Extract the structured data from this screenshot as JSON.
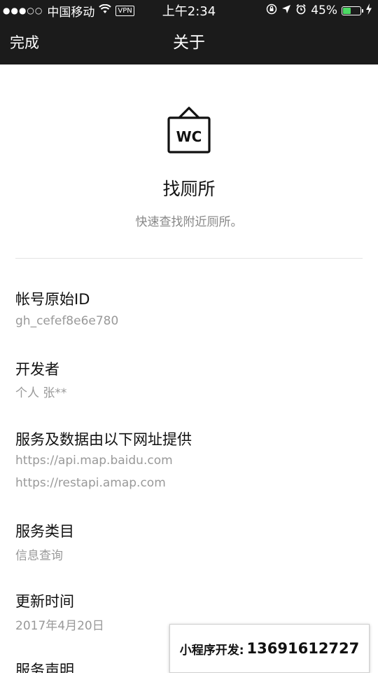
{
  "status_bar": {
    "carrier": "中国移动",
    "vpn": "VPN",
    "time": "上午2:34",
    "battery_percent": "45%",
    "battery_level": 0.45,
    "icons": [
      "signal-dots-icon",
      "wifi-icon",
      "orientation-lock-icon",
      "location-arrow-icon",
      "alarm-icon",
      "charging-bolt-icon"
    ]
  },
  "nav": {
    "done_label": "完成",
    "title": "关于"
  },
  "app": {
    "logo_icon": "wc-sign-icon",
    "name": "找厕所",
    "description": "快速查找附近厕所。"
  },
  "sections": {
    "account_id": {
      "title": "帐号原始ID",
      "value": "gh_cefef8e6e780"
    },
    "developer": {
      "title": "开发者",
      "value": "个人 张**"
    },
    "service_urls": {
      "title": "服务及数据由以下网址提供",
      "values": [
        "https://api.map.baidu.com",
        "https://restapi.amap.com"
      ]
    },
    "category": {
      "title": "服务类目",
      "value": "信息查询"
    },
    "updated": {
      "title": "更新时间",
      "value": "2017年4月20日"
    },
    "statement": {
      "title": "服务声明"
    }
  },
  "banner": {
    "label": "小程序开发:",
    "phone": "13691612727"
  },
  "colors": {
    "bar_bg": "#1b1b1b",
    "battery_green": "#4cd964",
    "muted_text": "#999999"
  }
}
